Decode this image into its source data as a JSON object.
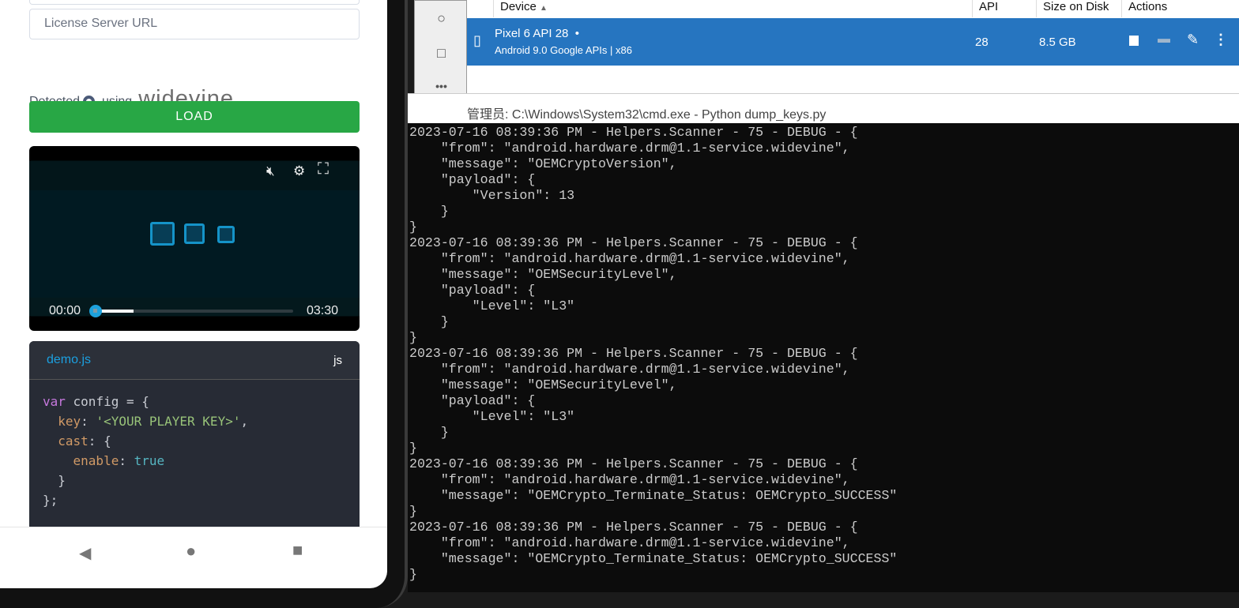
{
  "phone": {
    "license_placeholder": "License Server URL",
    "detected_label": "Detected",
    "using_label": ", using",
    "drm_logo": "widevine",
    "load_button": "LOAD",
    "player": {
      "current_time": "00:00",
      "duration": "03:30",
      "progress_fraction": 0.0,
      "buffered_fraction": 0.19
    },
    "code": {
      "filename": "demo.js",
      "language": "js",
      "lines": [
        [
          "var",
          " config = {"
        ],
        [
          "key",
          ": ",
          "'<YOUR PLAYER KEY>'",
          ","
        ],
        [
          "cast",
          ": {"
        ],
        [
          "enable",
          ": ",
          "true"
        ],
        [
          "}"
        ],
        [
          "};"
        ]
      ]
    }
  },
  "device_manager": {
    "columns": [
      "Device",
      "API",
      "Size on Disk",
      "Actions"
    ],
    "device": {
      "name": "Pixel 6 API 28",
      "status_dot": "•",
      "subtitle": "Android 9.0 Google APIs | x86",
      "api": "28",
      "size": "8.5 GB"
    }
  },
  "cmd": {
    "title": "管理员: C:\\Windows\\System32\\cmd.exe - Python  dump_keys.py",
    "lines": [
      "2023-07-16 08:39:36 PM - Helpers.Scanner - 75 - DEBUG - {",
      "    \"from\": \"android.hardware.drm@1.1-service.widevine\",",
      "    \"message\": \"OEMCryptoVersion\",",
      "    \"payload\": {",
      "        \"Version\": 13",
      "    }",
      "}",
      "2023-07-16 08:39:36 PM - Helpers.Scanner - 75 - DEBUG - {",
      "    \"from\": \"android.hardware.drm@1.1-service.widevine\",",
      "    \"message\": \"OEMSecurityLevel\",",
      "    \"payload\": {",
      "        \"Level\": \"L3\"",
      "    }",
      "}",
      "2023-07-16 08:39:36 PM - Helpers.Scanner - 75 - DEBUG - {",
      "    \"from\": \"android.hardware.drm@1.1-service.widevine\",",
      "    \"message\": \"OEMSecurityLevel\",",
      "    \"payload\": {",
      "        \"Level\": \"L3\"",
      "    }",
      "}",
      "2023-07-16 08:39:36 PM - Helpers.Scanner - 75 - DEBUG - {",
      "    \"from\": \"android.hardware.drm@1.1-service.widevine\",",
      "    \"message\": \"OEMCrypto_Terminate_Status: OEMCrypto_SUCCESS\"",
      "}",
      "2023-07-16 08:39:36 PM - Helpers.Scanner - 75 - DEBUG - {",
      "    \"from\": \"android.hardware.drm@1.1-service.widevine\",",
      "    \"message\": \"OEMCrypto_Terminate_Status: OEMCrypto_SUCCESS\"",
      "}"
    ]
  }
}
